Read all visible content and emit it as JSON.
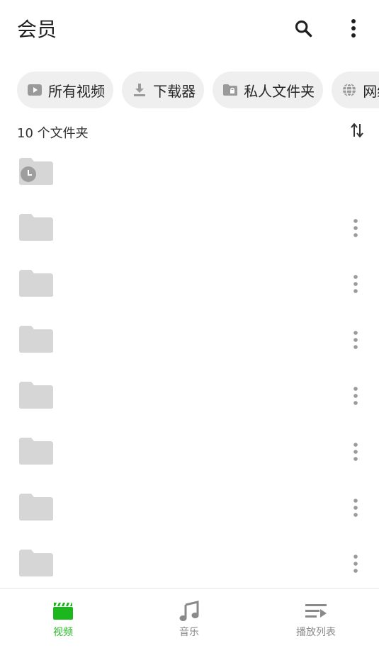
{
  "header": {
    "title": "会员",
    "search_icon": "search-icon",
    "more_icon": "more-vertical-icon"
  },
  "chips": [
    {
      "label": "所有视频",
      "icon": "play-icon"
    },
    {
      "label": "下载器",
      "icon": "download-icon"
    },
    {
      "label": "私人文件夹",
      "icon": "lock-folder-icon"
    },
    {
      "label": "网络",
      "icon": "globe-icon"
    }
  ],
  "list": {
    "count_label": "10 个文件夹",
    "sort_icon": "sort-icon",
    "folders": [
      {
        "icon": "history-folder-icon",
        "has_menu": false
      },
      {
        "icon": "folder-icon",
        "has_menu": true
      },
      {
        "icon": "folder-icon",
        "has_menu": true
      },
      {
        "icon": "folder-icon",
        "has_menu": true
      },
      {
        "icon": "folder-icon",
        "has_menu": true
      },
      {
        "icon": "folder-icon",
        "has_menu": true
      },
      {
        "icon": "folder-icon",
        "has_menu": true
      },
      {
        "icon": "folder-icon",
        "has_menu": true
      }
    ]
  },
  "bottom_nav": {
    "items": [
      {
        "label": "视频",
        "icon": "video-icon",
        "active": true
      },
      {
        "label": "音乐",
        "icon": "music-note-icon",
        "active": false
      },
      {
        "label": "播放列表",
        "icon": "playlist-icon",
        "active": false
      }
    ]
  },
  "colors": {
    "accent": "#2bb52b",
    "folder": "#d6d6d6",
    "chip_bg": "#efefef",
    "inactive_icon": "#8a8a8a"
  }
}
